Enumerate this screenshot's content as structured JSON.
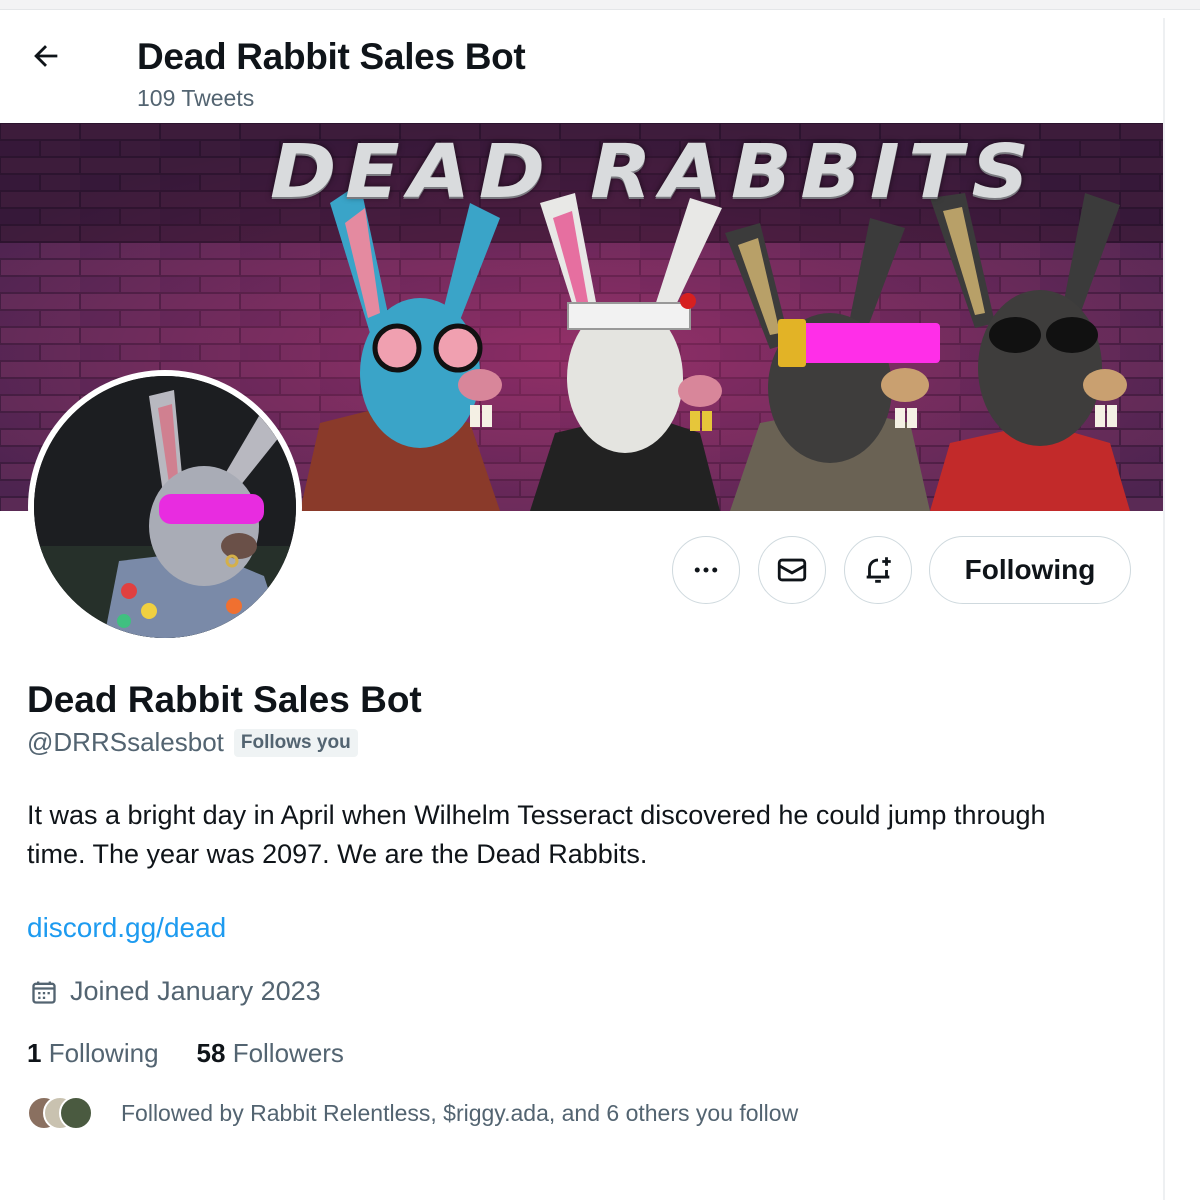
{
  "header": {
    "title": "Dead Rabbit Sales Bot",
    "tweet_count": "109 Tweets"
  },
  "banner": {
    "title_text": "DEAD RABBITS"
  },
  "actions": {
    "following_label": "Following"
  },
  "profile": {
    "name": "Dead Rabbit Sales Bot",
    "handle": "@DRRSsalesbot",
    "follows_you_badge": "Follows you",
    "bio": "It was a bright day in April when Wilhelm Tesseract discovered he could jump through time.  The year was 2097.  We are the Dead Rabbits.",
    "link": "discord.gg/dead",
    "joined": "Joined January 2023",
    "following_count": "1",
    "following_label": "Following",
    "followers_count": "58",
    "followers_label": "Followers",
    "followed_by": "Followed by Rabbit Relentless, $riggy.ada, and 6 others you follow"
  },
  "icons": {
    "back": "arrow-left-icon",
    "more": "more-icon",
    "message": "envelope-icon",
    "notify": "bell-plus-icon",
    "calendar": "calendar-icon"
  },
  "colors": {
    "link": "#1d9bf0",
    "secondary_text": "#536471",
    "border": "#cfd9de"
  }
}
